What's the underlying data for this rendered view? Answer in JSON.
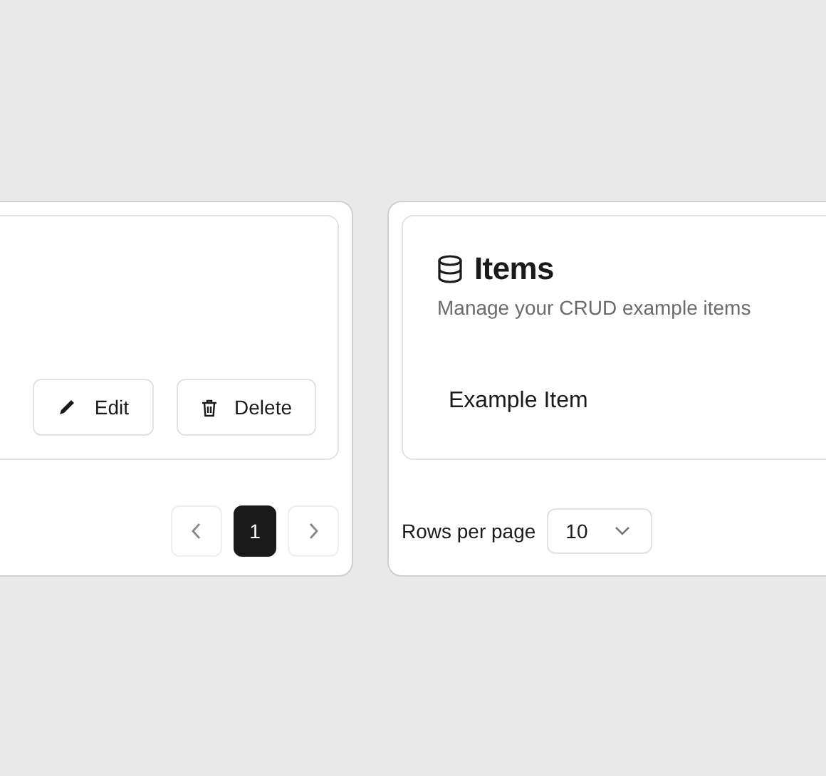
{
  "left_panel": {
    "actions": [
      {
        "kind": "edit",
        "label": "Edit"
      },
      {
        "kind": "delete",
        "label": "Delete"
      }
    ],
    "pagination": {
      "pages": [
        {
          "label": "1",
          "selected": true
        }
      ]
    }
  },
  "right_panel": {
    "title": "Items",
    "subtitle": "Manage your CRUD example items",
    "items": [
      {
        "name": "Example Item"
      }
    ],
    "rows_per_page": {
      "label": "Rows per page",
      "value": "10"
    }
  }
}
